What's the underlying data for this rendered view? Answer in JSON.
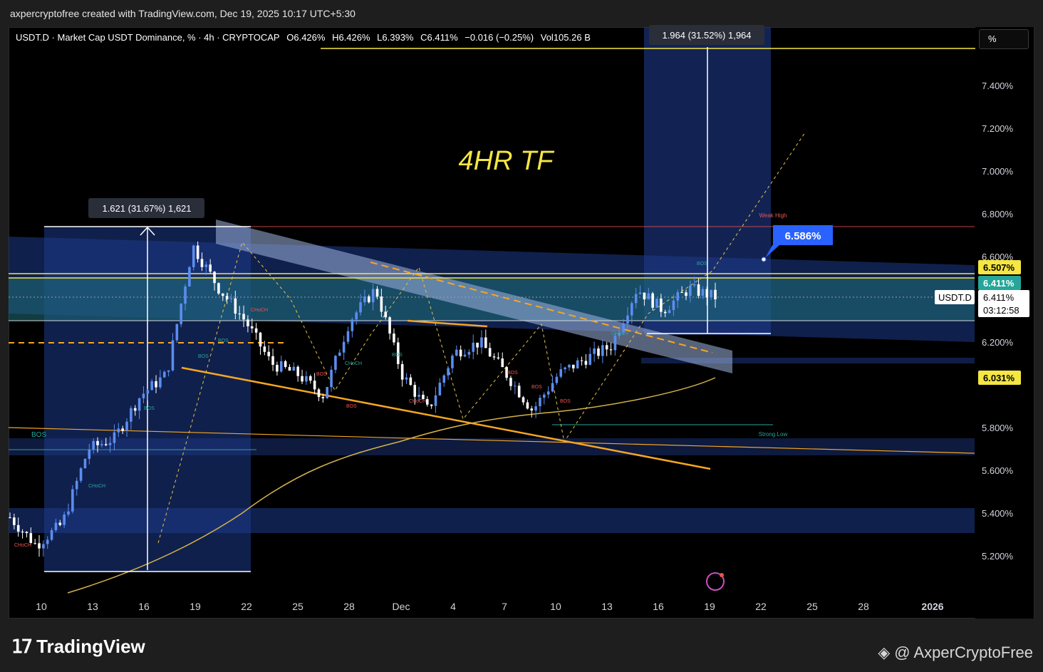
{
  "header": {
    "attribution": "axpercryptofree created with TradingView.com, Dec 19, 2025 10:17 UTC+5:30"
  },
  "symbol_line": {
    "name": "USDT.D · Market Cap USDT Dominance, % · 4h · CRYPTOCAP",
    "open": "O6.426%",
    "high": "H6.426%",
    "low": "L6.393%",
    "close": "C6.411%",
    "change": "−0.016 (−0.25%)",
    "volume": "Vol105.26 B"
  },
  "scale_button": {
    "label": "%"
  },
  "annotations": {
    "tf_label": "4HR TF",
    "measure_left": "1.621 (31.67%) 1,621",
    "measure_right": "1.964 (31.52%) 1,964",
    "target_callout": "6.586%",
    "weak_high": "Weak High",
    "strong_low": "Strong Low"
  },
  "price_axis": {
    "ticks": [
      "7.400%",
      "7.200%",
      "7.000%",
      "6.800%",
      "6.600%",
      "6.200%",
      "5.800%",
      "5.600%",
      "5.400%",
      "5.200%"
    ],
    "badges": {
      "yellow_top": "6.507%",
      "green": "6.411%",
      "symbol": "USDT.D",
      "last": "6.411%",
      "countdown": "03:12:58",
      "yellow_bottom": "6.031%"
    }
  },
  "time_axis": {
    "labels": [
      "10",
      "13",
      "16",
      "19",
      "22",
      "25",
      "28",
      "Dec",
      "4",
      "7",
      "10",
      "13",
      "16",
      "19",
      "22",
      "25",
      "28",
      "2026"
    ]
  },
  "structure_labels": [
    "BOS",
    "CHoCH"
  ],
  "footer": {
    "brand": "TradingView",
    "credit": "@ AxperCryptoFree"
  },
  "colors": {
    "background": "#000000",
    "bull_candle": "#5b8def",
    "bear_candle": "#ffffff",
    "zone_blue": "#1e3a8a",
    "teal_zone": "#1f6f78",
    "orange_line": "#f5a623",
    "ma_line": "#d4b34a",
    "yellow_badge": "#f5e642",
    "green_badge": "#26a69a",
    "blue_callout": "#2962ff"
  },
  "chart_data": {
    "type": "candlestick",
    "symbol": "USDT.D",
    "interval": "4h",
    "y_unit": "%",
    "ylim": [
      5.1,
      7.6
    ],
    "x_labels": [
      "10",
      "13",
      "16",
      "19",
      "22",
      "25",
      "28",
      "Dec",
      "4",
      "7",
      "10",
      "13",
      "16",
      "19",
      "22",
      "25",
      "28",
      "2026"
    ],
    "approx_close_path": [
      {
        "x": "10",
        "v": 5.38
      },
      {
        "x": "11",
        "v": 5.25
      },
      {
        "x": "13",
        "v": 5.35
      },
      {
        "x": "15",
        "v": 5.7
      },
      {
        "x": "17",
        "v": 5.75
      },
      {
        "x": "19",
        "v": 5.95
      },
      {
        "x": "21",
        "v": 6.05
      },
      {
        "x": "22",
        "v": 6.65
      },
      {
        "x": "23",
        "v": 6.45
      },
      {
        "x": "25",
        "v": 6.3
      },
      {
        "x": "26",
        "v": 6.1
      },
      {
        "x": "28",
        "v": 6.05
      },
      {
        "x": "29",
        "v": 5.95
      },
      {
        "x": "Dec",
        "v": 6.3
      },
      {
        "x": "2",
        "v": 6.45
      },
      {
        "x": "3",
        "v": 6.05
      },
      {
        "x": "4",
        "v": 5.88
      },
      {
        "x": "6",
        "v": 6.15
      },
      {
        "x": "8",
        "v": 6.2
      },
      {
        "x": "9",
        "v": 6.05
      },
      {
        "x": "10",
        "v": 5.88
      },
      {
        "x": "12",
        "v": 6.05
      },
      {
        "x": "13",
        "v": 6.12
      },
      {
        "x": "15",
        "v": 6.18
      },
      {
        "x": "16",
        "v": 6.45
      },
      {
        "x": "17",
        "v": 6.35
      },
      {
        "x": "18",
        "v": 6.45
      },
      {
        "x": "19",
        "v": 6.411
      }
    ],
    "levels": {
      "open": 6.426,
      "high": 6.426,
      "low": 6.393,
      "close": 6.411,
      "weak_high": 6.74,
      "strong_low": 5.82,
      "yellow_top": 6.507,
      "yellow_bottom": 6.031,
      "target": 6.586
    },
    "measurements": [
      {
        "label": "1.621 (31.67%) 1,621"
      },
      {
        "label": "1.964 (31.52%) 1,964"
      }
    ]
  }
}
